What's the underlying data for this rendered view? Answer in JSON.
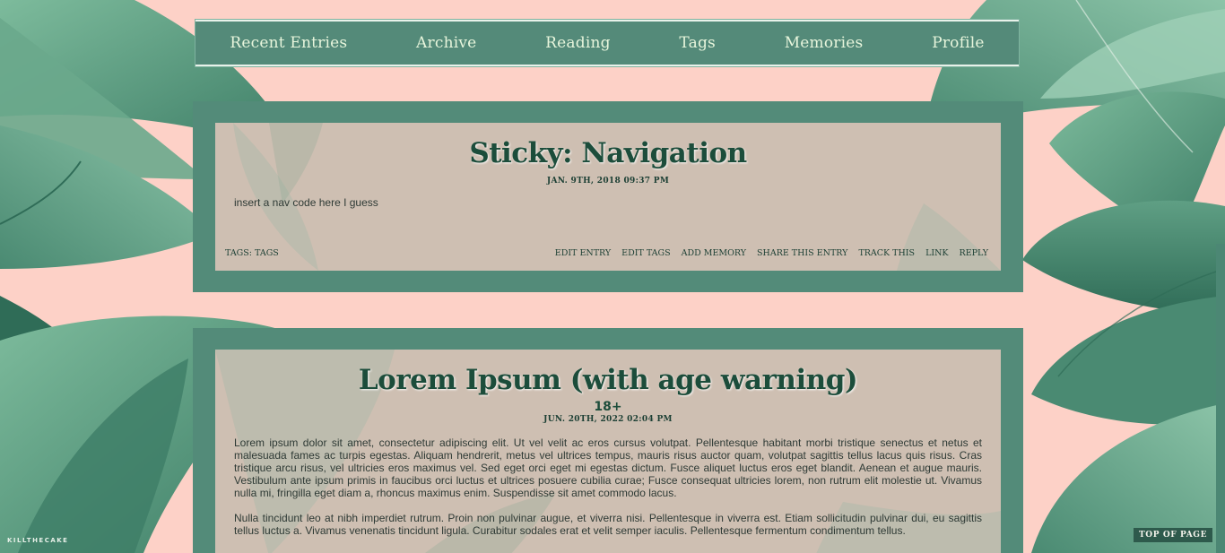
{
  "nav": {
    "items": [
      {
        "label": "Recent Entries"
      },
      {
        "label": "Archive"
      },
      {
        "label": "Reading"
      },
      {
        "label": "Tags"
      },
      {
        "label": "Memories"
      },
      {
        "label": "Profile"
      }
    ]
  },
  "entries": [
    {
      "title": "Sticky: Navigation",
      "date": "JAN. 9TH, 2018 09:37 PM",
      "body": [
        "insert a nav code here I guess"
      ],
      "tags_label": "TAGS:",
      "tags": "TAGS",
      "actions": [
        "EDIT ENTRY",
        "EDIT TAGS",
        "ADD MEMORY",
        "SHARE THIS ENTRY",
        "TRACK THIS",
        "LINK",
        "REPLY"
      ]
    },
    {
      "title": "Lorem Ipsum (with age warning)",
      "rating": "18+",
      "date": "JUN. 20TH, 2022 02:04 PM",
      "body": [
        "Lorem ipsum dolor sit amet, consectetur adipiscing elit. Ut vel velit ac eros cursus volutpat. Pellentesque habitant morbi tristique senectus et netus et malesuada fames ac turpis egestas. Aliquam hendrerit, metus vel ultrices tempus, mauris risus auctor quam, volutpat sagittis tellus lacus quis risus. Cras tristique arcu risus, vel ultricies eros maximus vel. Sed eget orci eget mi egestas dictum. Fusce aliquet luctus eros eget blandit. Aenean et augue mauris. Vestibulum ante ipsum primis in faucibus orci luctus et ultrices posuere cubilia curae; Fusce consequat ultricies lorem, non rutrum elit molestie ut. Vivamus nulla mi, fringilla eget diam a, rhoncus maximus enim. Suspendisse sit amet commodo lacus.",
        "Nulla tincidunt leo at nibh imperdiet rutrum. Proin non pulvinar augue, et viverra nisi. Pellentesque in viverra est. Etiam sollicitudin pulvinar dui, eu sagittis tellus luctus a. Vivamus venenatis tincidunt ligula. Curabitur sodales erat et velit semper iaculis. Pellentesque fermentum condimentum tellus."
      ]
    }
  ],
  "credit": "KILLTHECAKE",
  "top_of_page": "TOP OF PAGE",
  "colors": {
    "background": "#fdd1c7",
    "accent": "#538b79",
    "nav_text": "#e7f5dc",
    "text": "#1c4d3b"
  }
}
